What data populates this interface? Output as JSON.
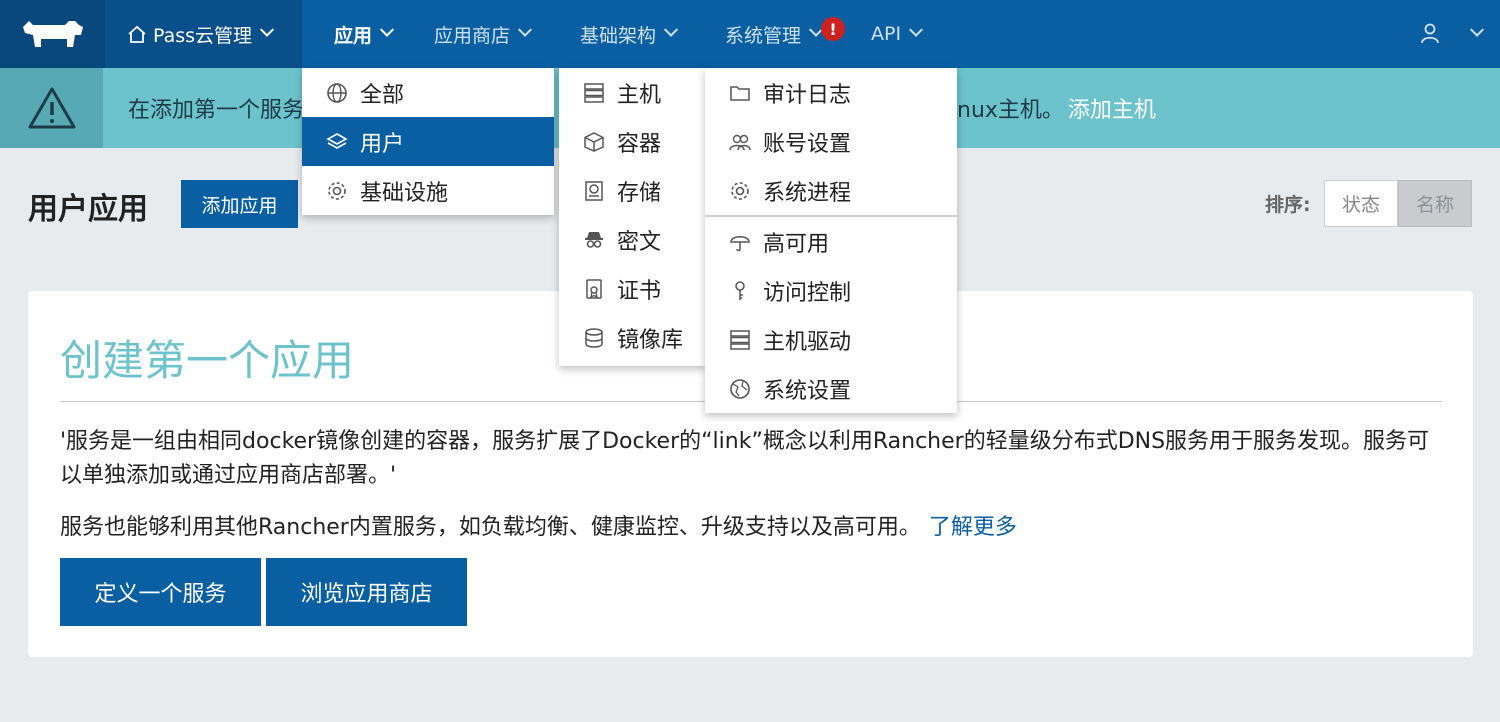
{
  "nav": {
    "env_label": "Pass云管理",
    "items": [
      {
        "label": "应用"
      },
      {
        "label": "应用商店"
      },
      {
        "label": "基础架构"
      },
      {
        "label": "系统管理"
      },
      {
        "label": "API"
      }
    ],
    "alert_badge": "!"
  },
  "banner": {
    "text_start": "在添加第一个服务",
    "text_end": "nux主机。",
    "link": "添加主机"
  },
  "header": {
    "title": "用户应用",
    "add_button": "添加应用",
    "sort_label": "排序:",
    "sort_options": [
      "状态",
      "名称"
    ]
  },
  "card": {
    "title": "创建第一个应用",
    "paragraph1": "'服务是一组由相同docker镜像创建的容器，服务扩展了Docker的“link”概念以利用Rancher的轻量级分布式DNS服务用于服务发现。服务可以单独添加或通过应用商店部署。'",
    "paragraph2": "服务也能够利用其他Rancher内置服务，如负载均衡、健康监控、升级支持以及高可用。",
    "learn_more": "了解更多",
    "button1": "定义一个服务",
    "button2": "浏览应用商店"
  },
  "menu_apps": [
    {
      "label": "全部",
      "icon": "globe-icon"
    },
    {
      "label": "用户",
      "icon": "layers-icon"
    },
    {
      "label": "基础设施",
      "icon": "gear-icon"
    }
  ],
  "menu_infra": [
    {
      "label": "主机",
      "icon": "server-icon"
    },
    {
      "label": "容器",
      "icon": "cube-icon"
    },
    {
      "label": "存储",
      "icon": "drive-icon"
    },
    {
      "label": "密文",
      "icon": "spy-icon"
    },
    {
      "label": "证书",
      "icon": "certificate-icon"
    },
    {
      "label": "镜像库",
      "icon": "database-icon"
    }
  ],
  "menu_admin": [
    {
      "label": "审计日志",
      "icon": "folder-icon"
    },
    {
      "label": "账号设置",
      "icon": "users-icon"
    },
    {
      "label": "系统进程",
      "icon": "gear-icon"
    },
    {
      "label": "高可用",
      "icon": "umbrella-icon"
    },
    {
      "label": "访问控制",
      "icon": "key-icon"
    },
    {
      "label": "主机驱动",
      "icon": "server-icon"
    },
    {
      "label": "系统设置",
      "icon": "globe-icon"
    }
  ],
  "colors": {
    "nav": "#0a5fa3",
    "banner": "#6cc3cc",
    "accent": "#0a5fa3"
  }
}
